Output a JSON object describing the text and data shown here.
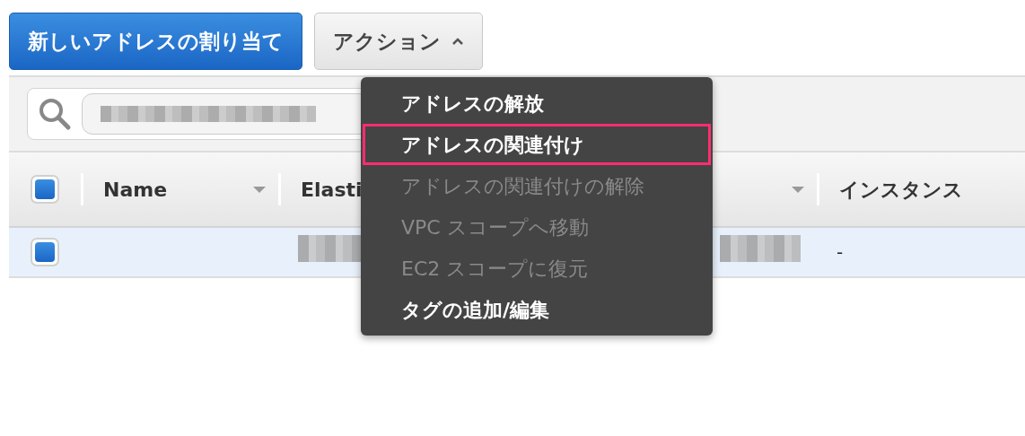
{
  "buttons": [
    {
      "label": "新しいアドレスの割り当て",
      "kind": "primary"
    },
    {
      "label": "アクション",
      "kind": "dropdown",
      "expanded": true
    }
  ],
  "action_menu": {
    "items": [
      {
        "label": "アドレスの解放",
        "disabled": false,
        "highlighted": false
      },
      {
        "label": "アドレスの関連付け",
        "disabled": false,
        "highlighted": true
      },
      {
        "label": "アドレスの関連付けの解除",
        "disabled": true,
        "highlighted": false
      },
      {
        "label": "VPC スコープへ移動",
        "disabled": true,
        "highlighted": false
      },
      {
        "label": "EC2 スコープに復元",
        "disabled": true,
        "highlighted": false
      },
      {
        "label": "タグの追加/編集",
        "disabled": false,
        "highlighted": false
      }
    ]
  },
  "table": {
    "select_all_checked": true,
    "columns": [
      {
        "label": "Name",
        "sortable": true
      },
      {
        "label": "Elasti",
        "sortable": false
      },
      {
        "sortable": true
      },
      {
        "label": "インスタンス",
        "sortable": false
      }
    ],
    "rows": [
      {
        "selected": true,
        "cells": [
          {
            "kind": "empty"
          },
          {
            "kind": "blurred"
          },
          {
            "kind": "blurred"
          },
          {
            "kind": "text",
            "text": "-"
          }
        ]
      }
    ]
  }
}
